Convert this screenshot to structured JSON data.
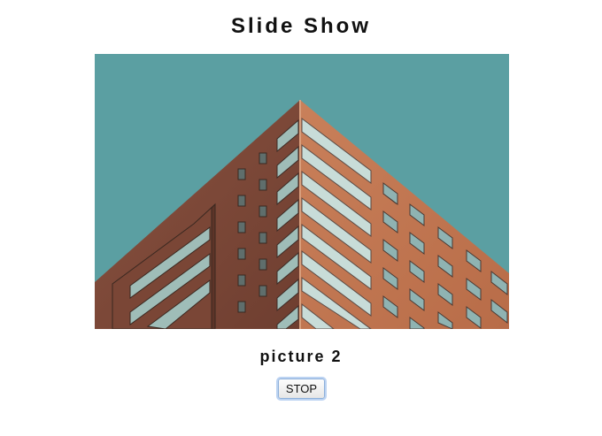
{
  "page": {
    "title": "Slide Show",
    "caption": "picture 2",
    "stop_label": "STOP"
  },
  "slide": {
    "subject": "corner of a brick apartment building against a teal sky",
    "colors": {
      "sky": "#5a9ea1",
      "left_facade": "#7e4a38",
      "right_facade": "#c47a55",
      "glass": "#c9d8d4"
    }
  }
}
